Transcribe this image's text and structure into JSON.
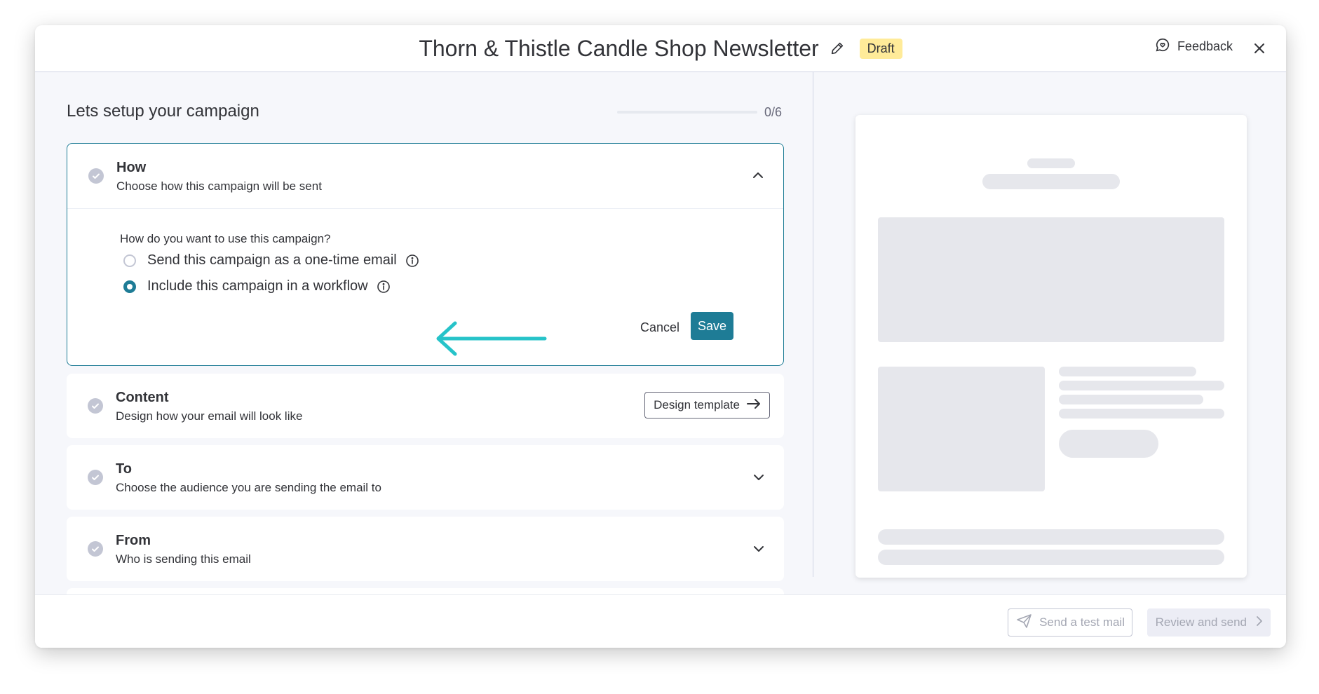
{
  "header": {
    "title": "Thorn & Thistle Candle Shop Newsletter",
    "status_badge": "Draft",
    "feedback_label": "Feedback"
  },
  "setup": {
    "title": "Lets setup your campaign",
    "progress_text": "0/6",
    "progress_fraction": 0
  },
  "sections": {
    "how": {
      "title": "How",
      "subtitle": "Choose how this campaign will be sent",
      "question": "How do you want to use this campaign?",
      "options": [
        {
          "label": "Send this campaign as a one-time email",
          "selected": false
        },
        {
          "label": "Include this campaign in a workflow",
          "selected": true
        }
      ],
      "cancel_label": "Cancel",
      "save_label": "Save"
    },
    "content": {
      "title": "Content",
      "subtitle": "Design how your email will look like",
      "button_label": "Design template"
    },
    "to": {
      "title": "To",
      "subtitle": "Choose the audience you are sending the email to"
    },
    "from": {
      "title": "From",
      "subtitle": "Who is sending this email"
    }
  },
  "footer": {
    "test_mail_label": "Send a test mail",
    "review_label": "Review and send"
  },
  "colors": {
    "accent": "#1e7c96",
    "annotation_arrow": "#26c3c9",
    "draft_badge": "#ffeb99"
  }
}
